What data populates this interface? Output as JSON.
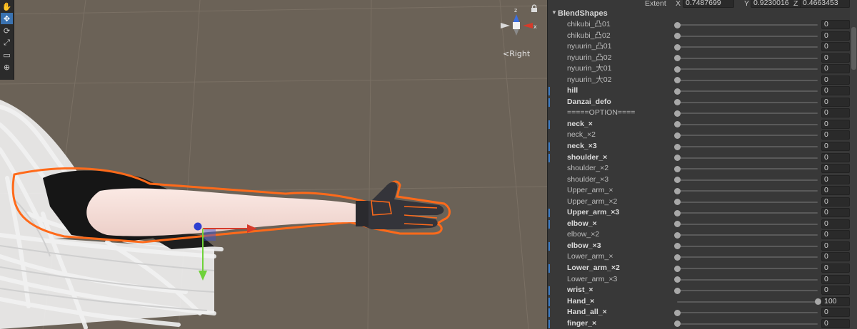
{
  "scene": {
    "tools": [
      {
        "icon": "hand-tool-icon",
        "glyph": "✋",
        "active": false
      },
      {
        "icon": "move-tool-icon",
        "glyph": "✥",
        "active": true
      },
      {
        "icon": "rotate-tool-icon",
        "glyph": "⟳",
        "active": false
      },
      {
        "icon": "scale-tool-icon",
        "glyph": "⤢",
        "active": false
      },
      {
        "icon": "rect-tool-icon",
        "glyph": "▭",
        "active": false
      },
      {
        "icon": "transform-tool-icon",
        "glyph": "⊕",
        "active": false
      }
    ],
    "gizmo": {
      "axis_label": "z",
      "view_label": "Right",
      "x_label": "x"
    },
    "colors": {
      "background": "#6b6257",
      "grid": "#7a7064",
      "selection_outline": "#ff6a1a",
      "x_axis": "#d63b2a",
      "y_axis": "#6fd23a",
      "z_axis": "#3b55d6"
    }
  },
  "inspector": {
    "extent": {
      "label": "Extent",
      "x_label": "X",
      "x": "0.7487699",
      "y_label": "Y",
      "y": "0.9230016",
      "z_label": "Z",
      "z": "0.4663453"
    },
    "section_title": "BlendShapes",
    "rows": [
      {
        "label": "chikubi_凸01",
        "value": "0",
        "fraction": 0,
        "bold": false,
        "marked": false
      },
      {
        "label": "chikubi_凸02",
        "value": "0",
        "fraction": 0,
        "bold": false,
        "marked": false
      },
      {
        "label": "nyuurin_凸01",
        "value": "0",
        "fraction": 0,
        "bold": false,
        "marked": false
      },
      {
        "label": "nyuurin_凸02",
        "value": "0",
        "fraction": 0,
        "bold": false,
        "marked": false
      },
      {
        "label": "nyuurin_大01",
        "value": "0",
        "fraction": 0,
        "bold": false,
        "marked": false
      },
      {
        "label": "nyuurin_大02",
        "value": "0",
        "fraction": 0,
        "bold": false,
        "marked": false
      },
      {
        "label": "hill",
        "value": "0",
        "fraction": 0,
        "bold": true,
        "marked": true
      },
      {
        "label": "Danzai_defo",
        "value": "0",
        "fraction": 0,
        "bold": true,
        "marked": true
      },
      {
        "label": "=====OPTION====",
        "value": "0",
        "fraction": 0,
        "bold": false,
        "marked": false
      },
      {
        "label": "neck_×",
        "value": "0",
        "fraction": 0,
        "bold": true,
        "marked": true
      },
      {
        "label": "neck_×2",
        "value": "0",
        "fraction": 0,
        "bold": false,
        "marked": false
      },
      {
        "label": "neck_×3",
        "value": "0",
        "fraction": 0,
        "bold": true,
        "marked": true
      },
      {
        "label": "shoulder_×",
        "value": "0",
        "fraction": 0,
        "bold": true,
        "marked": true
      },
      {
        "label": "shoulder_×2",
        "value": "0",
        "fraction": 0,
        "bold": false,
        "marked": false
      },
      {
        "label": "shoulder_×3",
        "value": "0",
        "fraction": 0,
        "bold": false,
        "marked": false
      },
      {
        "label": "Upper_arm_×",
        "value": "0",
        "fraction": 0,
        "bold": false,
        "marked": false
      },
      {
        "label": "Upper_arm_×2",
        "value": "0",
        "fraction": 0,
        "bold": false,
        "marked": false
      },
      {
        "label": "Upper_arm_×3",
        "value": "0",
        "fraction": 0,
        "bold": true,
        "marked": true
      },
      {
        "label": "elbow_×",
        "value": "0",
        "fraction": 0,
        "bold": true,
        "marked": true
      },
      {
        "label": "elbow_×2",
        "value": "0",
        "fraction": 0,
        "bold": false,
        "marked": false
      },
      {
        "label": "elbow_×3",
        "value": "0",
        "fraction": 0,
        "bold": true,
        "marked": true
      },
      {
        "label": "Lower_arm_×",
        "value": "0",
        "fraction": 0,
        "bold": false,
        "marked": false
      },
      {
        "label": "Lower_arm_×2",
        "value": "0",
        "fraction": 0,
        "bold": true,
        "marked": true
      },
      {
        "label": "Lower_arm_×3",
        "value": "0",
        "fraction": 0,
        "bold": false,
        "marked": false
      },
      {
        "label": "wrist_×",
        "value": "0",
        "fraction": 0,
        "bold": true,
        "marked": true
      },
      {
        "label": "Hand_×",
        "value": "100",
        "fraction": 1,
        "bold": true,
        "marked": true
      },
      {
        "label": "Hand_all_×",
        "value": "0",
        "fraction": 0,
        "bold": true,
        "marked": true
      },
      {
        "label": "finger_×",
        "value": "0",
        "fraction": 0,
        "bold": true,
        "marked": true
      }
    ]
  }
}
